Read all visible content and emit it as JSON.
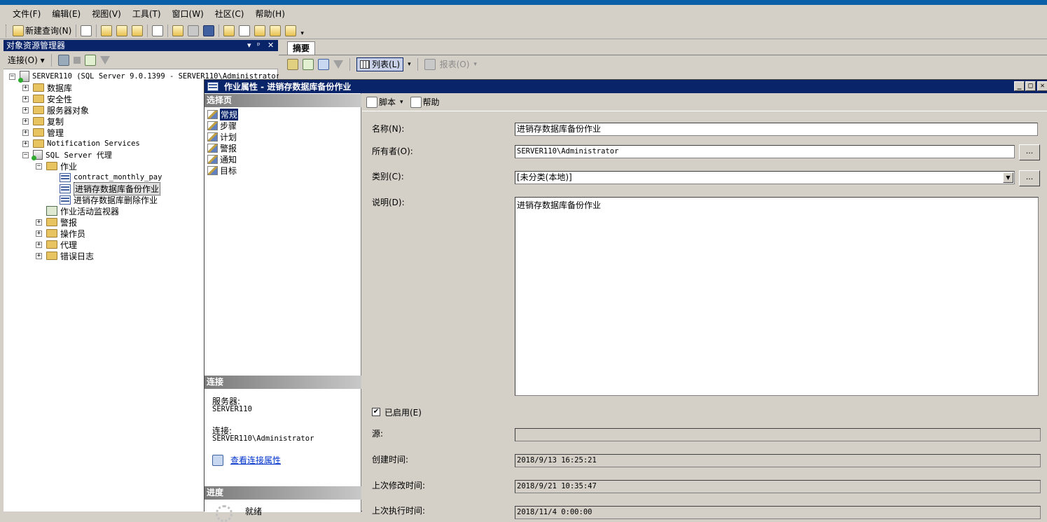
{
  "menu": [
    "文件(F)",
    "编辑(E)",
    "视图(V)",
    "工具(T)",
    "窗口(W)",
    "社区(C)",
    "帮助(H)"
  ],
  "toolbar": {
    "new_query": "新建查询(N)"
  },
  "object_explorer": {
    "title": "对象资源管理器",
    "title_controls": [
      "▾",
      "ᵖ",
      "✕"
    ],
    "connect": "连接(O) ▾",
    "server_node": "SERVER110 (SQL Server 9.0.1399 - SERVER110\\Administrator)",
    "nodes": [
      "数据库",
      "安全性",
      "服务器对象",
      "复制",
      "管理",
      "Notification Services"
    ],
    "agent": "SQL Server 代理",
    "jobs_folder": "作业",
    "jobs": [
      "contract_monthly_pay",
      "进销存数据库备份作业",
      "进销存数据库删除作业"
    ],
    "job_monitor": "作业活动监视器",
    "agent_children": [
      "警报",
      "操作员",
      "代理",
      "错误日志"
    ]
  },
  "summary": {
    "tab": "摘要",
    "list_button": "列表(L)",
    "report_button": "报表(O)"
  },
  "dialog": {
    "title": "作业属性 - 进销存数据库备份作业",
    "select_page_header": "选择页",
    "pages": [
      "常规",
      "步骤",
      "计划",
      "警报",
      "通知",
      "目标"
    ],
    "connection_header": "连接",
    "server_label": "服务器:",
    "server_value": "SERVER110",
    "connection_label": "连接:",
    "connection_value": "SERVER110\\Administrator",
    "view_connection_props": "查看连接属性",
    "progress_header": "进度",
    "progress_status": "就绪",
    "script_button": "脚本",
    "help_button": "帮助",
    "fields": {
      "name_label": "名称(N):",
      "name_value": "进销存数据库备份作业",
      "owner_label": "所有者(O):",
      "owner_value": "SERVER110\\Administrator",
      "category_label": "类别(C):",
      "category_value": "[未分类(本地)]",
      "description_label": "说明(D):",
      "description_value": "进销存数据库备份作业",
      "enabled_label": "已启用(E)",
      "enabled": true,
      "source_label": "源:",
      "source_value": "",
      "created_label": "创建时间:",
      "created_value": "2018/9/13 16:25:21",
      "modified_label": "上次修改时间:",
      "modified_value": "2018/9/21 10:35:47",
      "executed_label": "上次执行时间:",
      "executed_value": "2018/11/4 0:00:00"
    },
    "ellipsis": "..."
  }
}
